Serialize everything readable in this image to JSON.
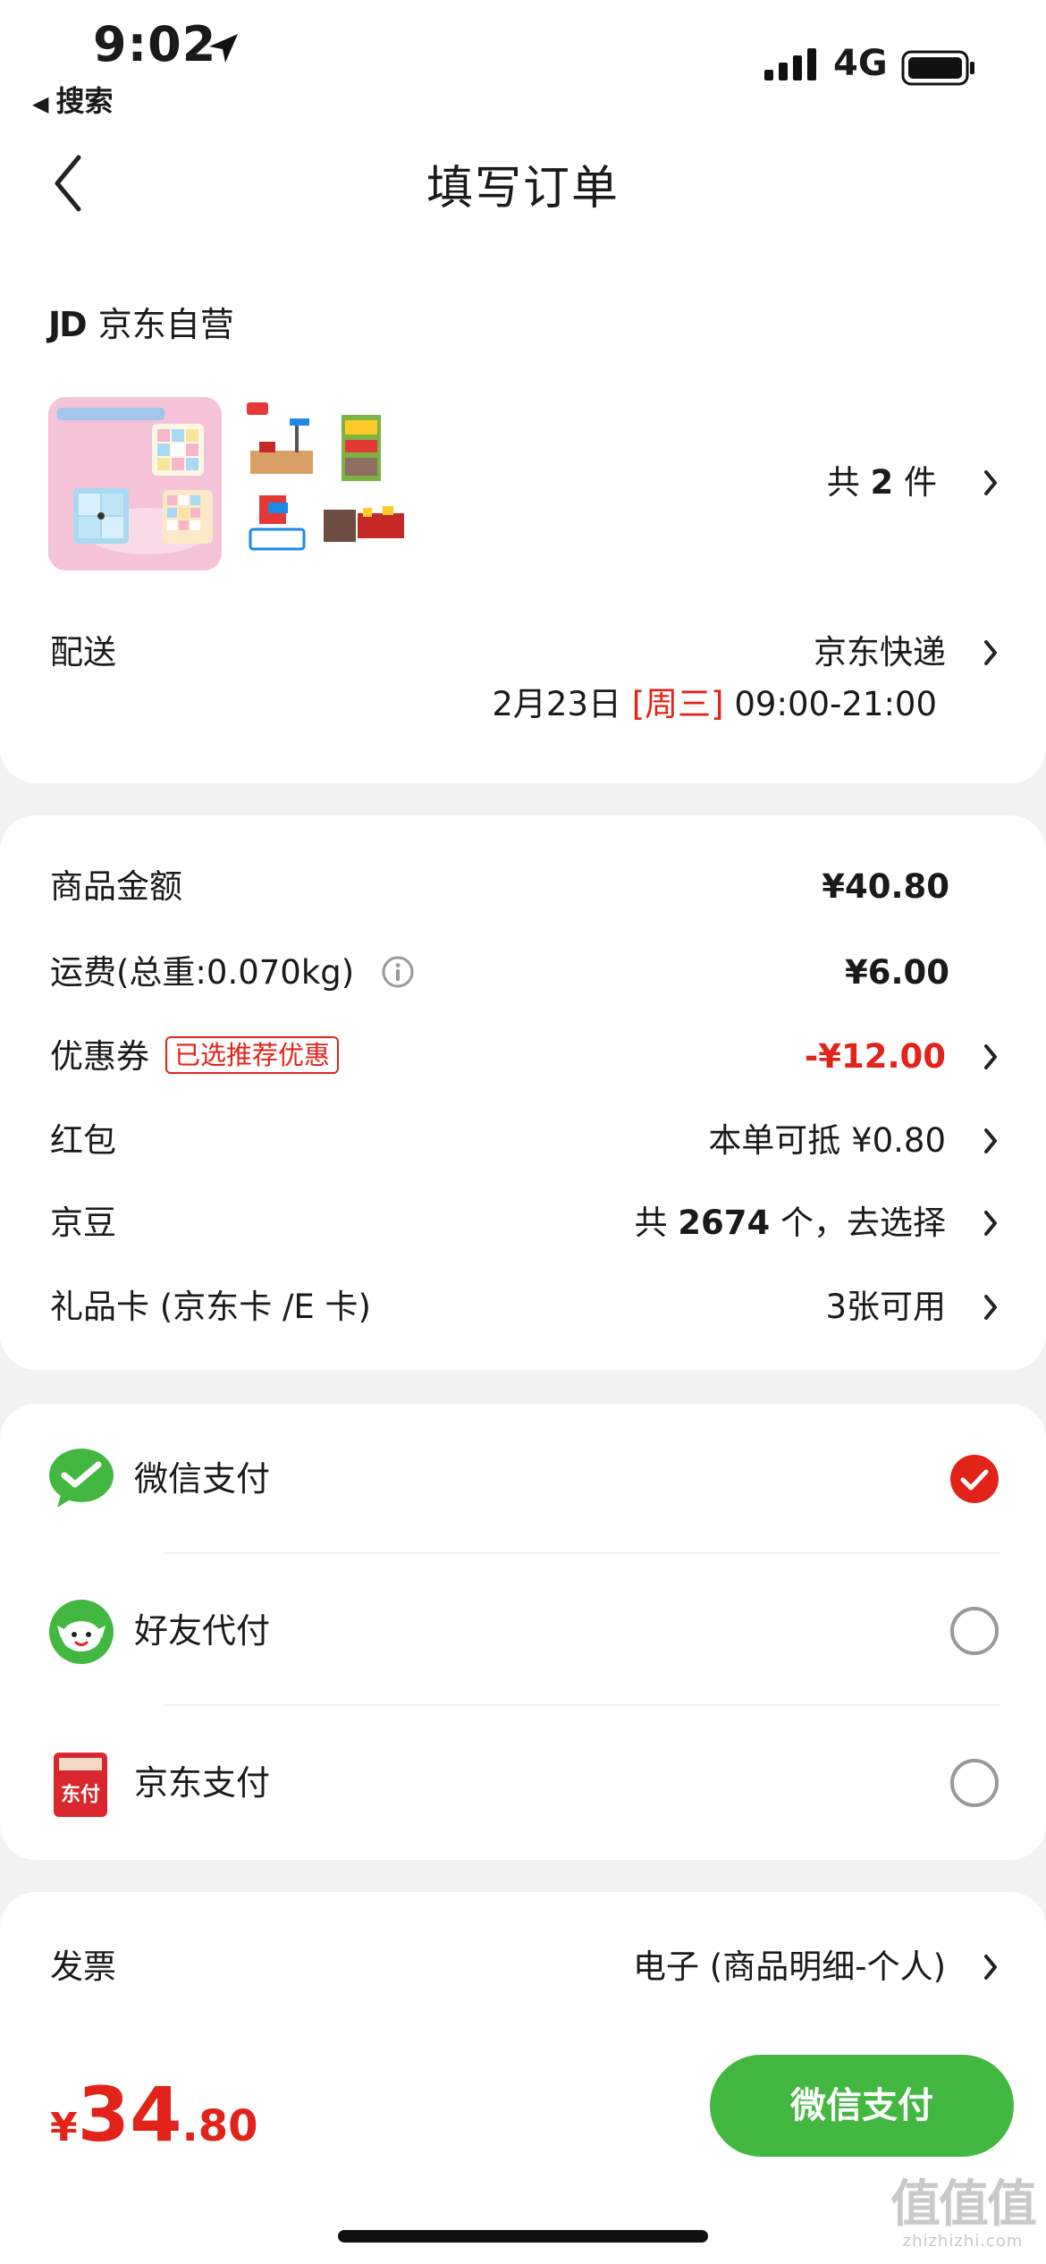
{
  "status_bar": {
    "time": "9:02",
    "back_app": "搜索",
    "network": "4G"
  },
  "nav": {
    "title": "填写订单"
  },
  "order": {
    "store_logo": "JD",
    "store_name": "京东自营",
    "item_count_prefix": "共",
    "item_count": "2",
    "item_count_suffix": "件",
    "delivery_label": "配送",
    "delivery_method": "京东快递",
    "delivery_date": "2月23日",
    "delivery_weekday": "[周三]",
    "delivery_time": "09:00-21:00"
  },
  "pricing": {
    "goods_label": "商品金额",
    "goods_value": "¥40.80",
    "shipping_label": "运费(总重:0.070kg)",
    "shipping_value": "¥6.00",
    "coupon_label": "优惠券",
    "coupon_tag": "已选推荐优惠",
    "coupon_value": "-¥12.00",
    "redpacket_label": "红包",
    "redpacket_value": "本单可抵 ¥0.80",
    "jingdou_label": "京豆",
    "jingdou_prefix": "共",
    "jingdou_count": "2674",
    "jingdou_suffix": "个，去选择",
    "giftcard_label": "礼品卡 (京东卡 /E 卡)",
    "giftcard_value": "3张可用"
  },
  "payment": {
    "methods": [
      {
        "label": "微信支付",
        "selected": true,
        "icon": "wechat-pay-icon"
      },
      {
        "label": "好友代付",
        "selected": false,
        "icon": "friend-pay-icon"
      },
      {
        "label": "京东支付",
        "selected": false,
        "icon": "jd-pay-icon",
        "icon_text": "东付"
      }
    ]
  },
  "invoice": {
    "label": "发票",
    "value": "电子 (商品明细-个人)"
  },
  "footer": {
    "currency": "¥",
    "total_int": "34",
    "total_dec": ".80",
    "pay_button": "微信支付",
    "watermark_logo": "值值值",
    "watermark_url": "zhizhizhi.com"
  },
  "colors": {
    "accent_red": "#e2231a",
    "wechat_green": "#42b841"
  }
}
